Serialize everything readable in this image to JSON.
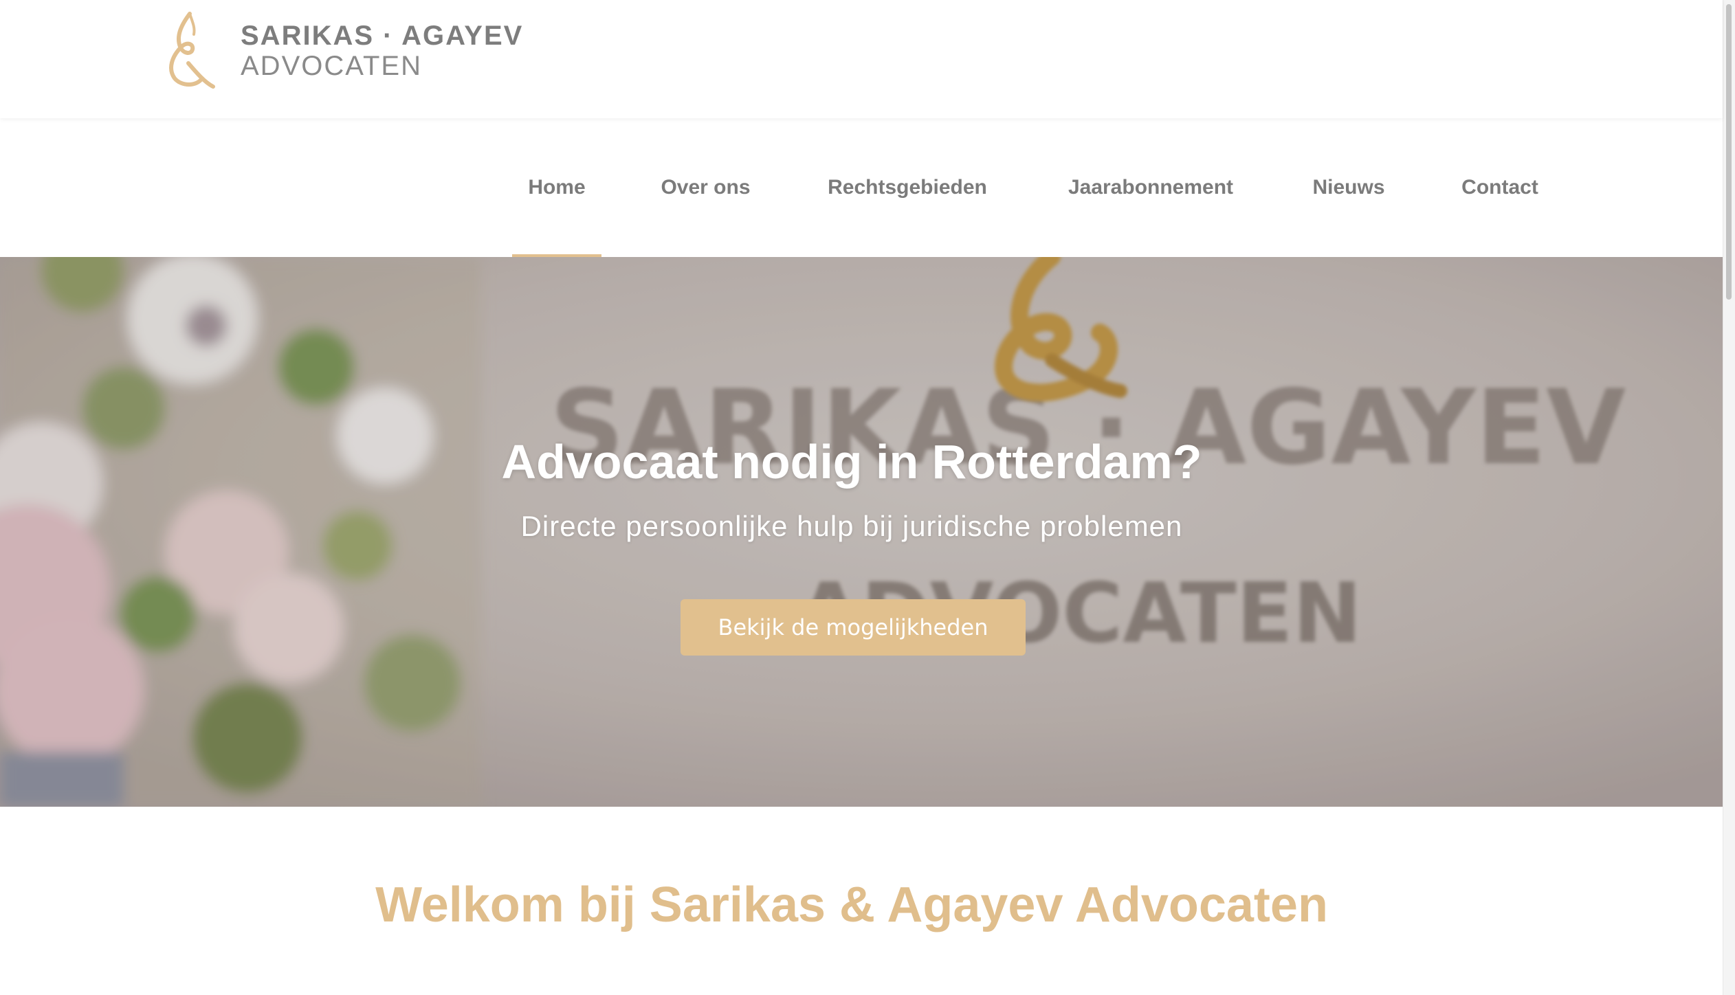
{
  "brand": {
    "name_line1": "SARIKAS · AGAYEV",
    "name_line2": "ADVOCATEN",
    "accent_color": "#e2c08f",
    "text_color": "#7b7b7b"
  },
  "nav": {
    "items": [
      {
        "label": "Home",
        "active": true
      },
      {
        "label": "Over ons",
        "active": false
      },
      {
        "label": "Rechtsgebieden",
        "active": false
      },
      {
        "label": "Jaarabonnement",
        "active": false
      },
      {
        "label": "Nieuws",
        "active": false
      },
      {
        "label": "Contact",
        "active": false
      }
    ]
  },
  "hero": {
    "title": "Advocaat nodig in Rotterdam?",
    "subtitle": "Directe persoonlijke hulp bij juridische problemen",
    "button_label": "Bekijk de mogelijkheden",
    "wall_sign_line1": "SARIKAS · AGAYEV",
    "wall_sign_line2": "ADVOCATEN"
  },
  "welcome": {
    "title": "Welkom bij Sarikas & Agayev Advocaten"
  }
}
